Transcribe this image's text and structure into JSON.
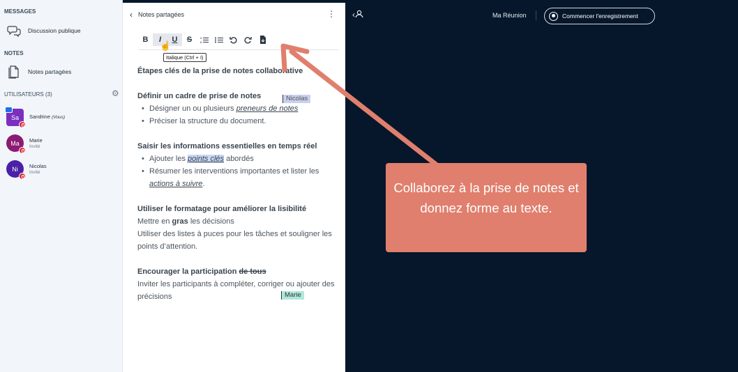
{
  "sidebar": {
    "messages_title": "MESSAGES",
    "public_chat": "Discussion publique",
    "notes_title": "NOTES",
    "shared_notes": "Notes partagées",
    "users_title": "UTILISATEURS (3)",
    "users": [
      {
        "initials": "Sa",
        "name": "Sandrine",
        "suffix": "(Vous)",
        "role": "",
        "color": "#7b2fbf"
      },
      {
        "initials": "Ma",
        "name": "Marie",
        "suffix": "",
        "role": "Invité",
        "color": "#8a1d73"
      },
      {
        "initials": "Ni",
        "name": "Nicolas",
        "suffix": "",
        "role": "Invité",
        "color": "#4a21a6"
      }
    ]
  },
  "notes": {
    "header": "Notes partagées",
    "toolbar": {
      "bold": "B",
      "italic": "I",
      "underline": "U",
      "strike": "S",
      "tooltip": "Italique (Ctrl + I)"
    },
    "doc": {
      "title": "Étapes clés de la prise de notes collaborative",
      "s1_title": "Définir un cadre de prise de notes",
      "s1_b1_pre": "Désigner un ou plusieurs ",
      "s1_b1_link": "preneurs de notes",
      "s1_b2": "Préciser la structure du document.",
      "s2_title": "Saisir les informations essentielles en temps réel",
      "s2_b1_pre": "Ajouter les ",
      "s2_b1_hl": "points clés",
      "s2_b1_post": " abordés",
      "s2_b2_pre": "Résumer les interventions importantes et lister les ",
      "s2_b2_link": "actions à suivre",
      "s2_b2_post": ".",
      "s3_title": "Utiliser le formatage pour améliorer la lisibilité",
      "s3_l1_pre": "Mettre en ",
      "s3_l1_bold": "gras",
      "s3_l1_post": " les décisions",
      "s3_l2": "Utiliser des listes à puces pour les tâches et souligner les points d’attention.",
      "s4_title_pre": "Encourager la participation ",
      "s4_title_strike": "de tous",
      "s4_l1": "Inviter les participants à compléter, corriger ou ajouter des précisions"
    },
    "cursors": {
      "nicolas": "Nicolas",
      "marie": "Marie"
    }
  },
  "topbar": {
    "meeting_name": "Ma Réunion",
    "record_label": "Commencer l'enregistrement"
  },
  "callout": {
    "text": "Collaborez à la prise de notes et donnez forme au texte."
  },
  "colors": {
    "callout": "#e07f6d",
    "background": "#06172b"
  }
}
